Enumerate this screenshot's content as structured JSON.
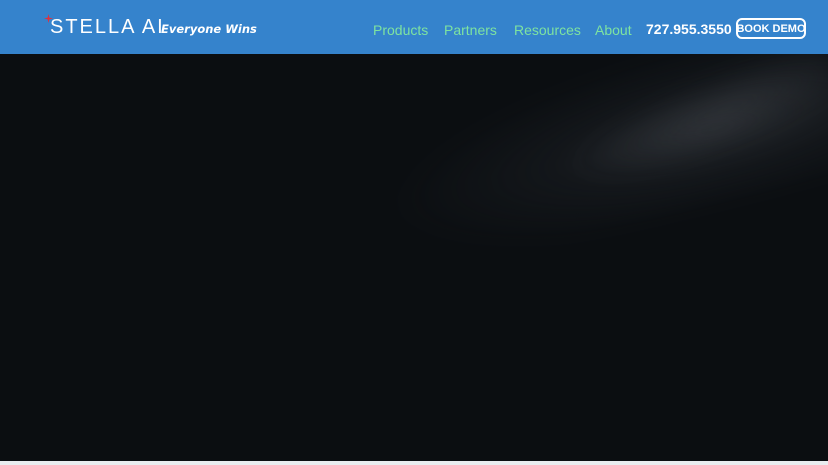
{
  "brand": {
    "wordmark": "STELLA AI",
    "tagline": "Everyone Wins",
    "spark_color": "#e0313d"
  },
  "nav": {
    "links": [
      {
        "label": "Products"
      },
      {
        "label": "Partners"
      },
      {
        "label": "Resources"
      },
      {
        "label": "About"
      }
    ],
    "phone": "727.955.3550",
    "cta_label": "BOOK DEMO"
  },
  "colors": {
    "navbar_bg": "#3583cc",
    "nav_link": "#7ee3a0",
    "hero_bg": "#0b0e11"
  }
}
